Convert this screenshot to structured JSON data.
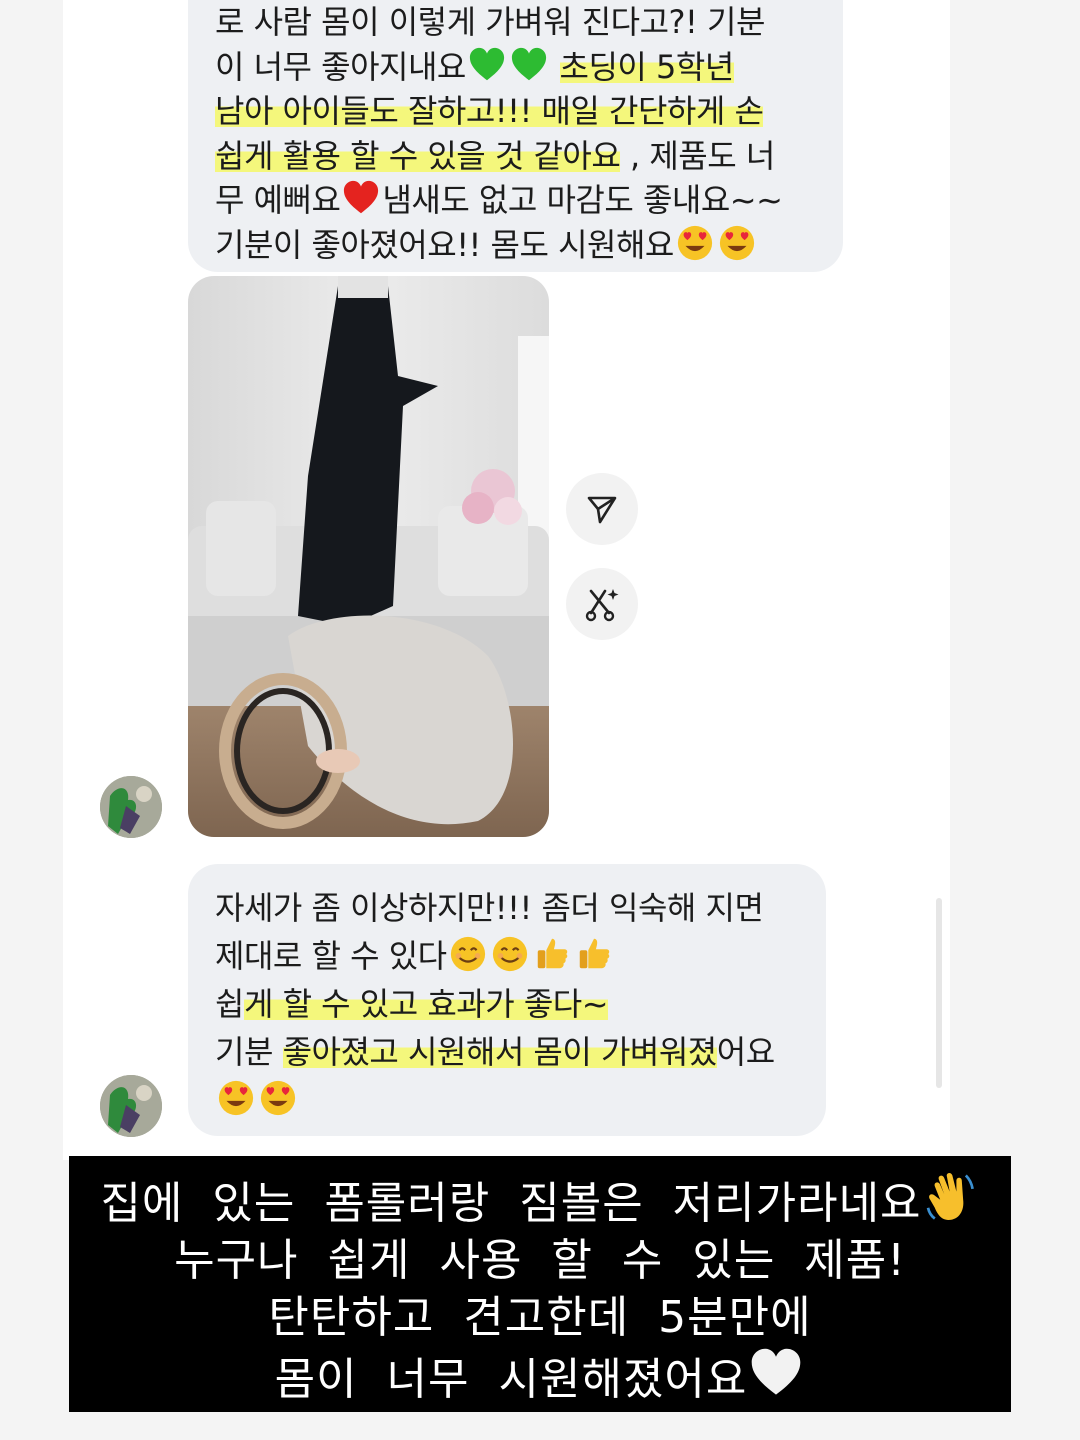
{
  "messages": [
    {
      "id": "review-message-1",
      "lines": [
        [
          {
            "t": "로 사람 몸이 이렇게 가벼워 진다고?! 기분",
            "hl": false
          }
        ],
        [
          {
            "t": "이 너무 좋아지내요",
            "hl": false
          },
          {
            "emoji": "green-heart"
          },
          {
            "emoji": "green-heart"
          },
          {
            "t": " ",
            "hl": false
          },
          {
            "t": "초딩이 5학년",
            "hl": true
          }
        ],
        [
          {
            "t": "남아 아이들도 잘하고!!! 매일 간단하게 손",
            "hl": true
          }
        ],
        [
          {
            "t": "쉽게 활용 할 수 있을 것 같아요",
            "hl": true
          },
          {
            "t": " , 제품도 너",
            "hl": false
          }
        ],
        [
          {
            "t": "무 예뻐요",
            "hl": false
          },
          {
            "emoji": "red-heart"
          },
          {
            "t": "냄새도 없고 마감도 좋내요~~",
            "hl": false
          }
        ],
        [
          {
            "t": "기분이 좋아졌어요!! 몸도 시원해요",
            "hl": false
          },
          {
            "emoji": "heart-eyes"
          },
          {
            "emoji": "heart-eyes"
          }
        ]
      ]
    },
    {
      "id": "review-message-2",
      "lines": [
        [
          {
            "t": "자세가 좀 이상하지만!!! 좀더 익숙해 지면",
            "hl": false
          }
        ],
        [
          {
            "t": "제대로 할 수 있다",
            "hl": false
          },
          {
            "emoji": "smile"
          },
          {
            "emoji": "smile"
          },
          {
            "emoji": "thumbs-up"
          },
          {
            "emoji": "thumbs-up"
          }
        ],
        [
          {
            "t": "쉽",
            "hl": false
          },
          {
            "t": "게 할 수 있고 효과가 좋다~",
            "hl": true
          }
        ],
        [
          {
            "t": "기분 ",
            "hl": false
          },
          {
            "t": "좋아졌고 시원해서 몸이 가벼워졌",
            "hl": true
          },
          {
            "t": "어요",
            "hl": false
          }
        ],
        [
          {
            "emoji": "heart-eyes"
          },
          {
            "emoji": "heart-eyes"
          }
        ]
      ]
    }
  ],
  "photo": {
    "alt": "photo",
    "icons": [
      "share-icon",
      "remix-icon"
    ]
  },
  "caption": {
    "lines": [
      [
        {
          "t": "집에 있는 폼롤러랑 짐볼은 저리가라네요"
        },
        {
          "emoji": "waving-hand"
        }
      ],
      [
        {
          "t": "누구나 쉽게 사용 할 수 있는 제품!"
        }
      ],
      [
        {
          "t": "탄탄하고 견고한데 5분만에"
        }
      ],
      [
        {
          "t": "몸이 너무 시원해졌어요"
        },
        {
          "emoji": "white-heart"
        }
      ]
    ]
  },
  "colors": {
    "bubble": "#eef0f3",
    "highlight": "#f4f77c",
    "caption_bg": "#000000",
    "caption_text": "#ffffff"
  }
}
